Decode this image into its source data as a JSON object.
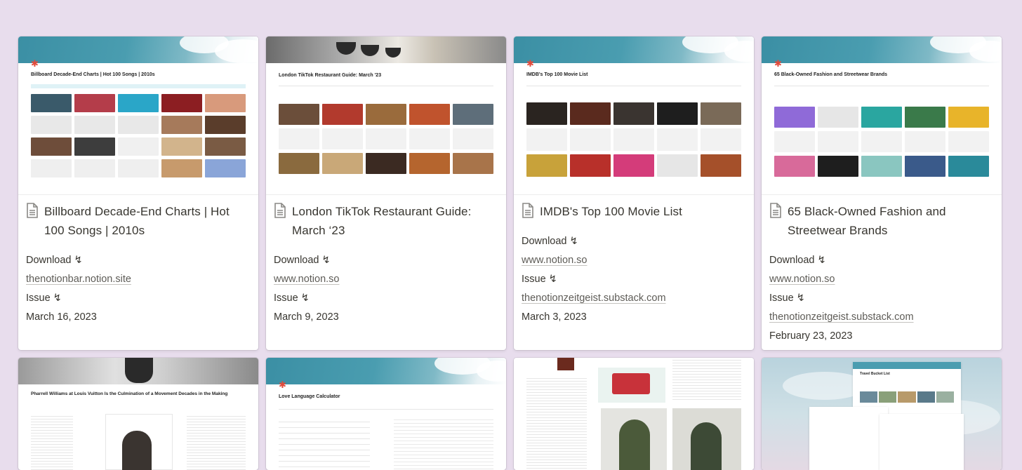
{
  "cards": [
    {
      "cover_title": "Billboard Decade-End Charts | Hot 100 Songs | 2010s",
      "title": "Billboard Decade-End Charts | Hot 100 Songs | 2010s",
      "download": "Download ↯",
      "link1": "thenotionbar.notion.site",
      "issue": "Issue ↯",
      "link2": "",
      "date": "March 16, 2023"
    },
    {
      "cover_title": "London TikTok Restaurant Guide: March '23",
      "title": "London TikTok Restaurant Guide: March ‘23",
      "download": "Download ↯",
      "link1": "www.notion.so",
      "issue": "Issue ↯",
      "link2": "",
      "date": "March 9, 2023"
    },
    {
      "cover_title": "IMDB's Top 100 Movie List",
      "title": "IMDB's Top 100 Movie List",
      "download": "Download ↯",
      "link1": "www.notion.so",
      "issue": "Issue ↯",
      "link2": "thenotionzeitgeist.substack.com",
      "date": "March 3, 2023"
    },
    {
      "cover_title": "65 Black-Owned Fashion and Streetwear Brands",
      "title": "65 Black-Owned Fashion and Streetwear Brands",
      "download": "Download ↯",
      "link1": "www.notion.so",
      "issue": "Issue ↯",
      "link2": "thenotionzeitgeist.substack.com",
      "date": "February 23, 2023"
    }
  ],
  "row2": [
    {
      "cover_title": "Pharrell Williams at Louis Vuitton Is the Culmination of a Movement Decades in the Making"
    },
    {
      "cover_title": "Love Language Calculator"
    },
    {
      "cover_title": ""
    },
    {
      "cover_title": "Travel Bucket List"
    }
  ],
  "colors": {
    "background": "#e8dded",
    "card": "#ffffff",
    "text": "#37352f",
    "sky": "#3b8fa4",
    "spark": "#e24a3b"
  },
  "icons": {
    "page": "page-icon"
  }
}
